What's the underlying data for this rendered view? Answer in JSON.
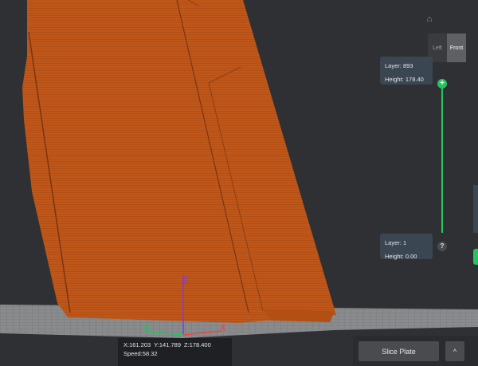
{
  "toolbar": {
    "home_icon": "home-icon",
    "view_left_label": "Left",
    "view_front_label": "Front"
  },
  "layer_slider": {
    "top": {
      "layer_label": "Layer:",
      "layer_value": "893",
      "height_label": "Height:",
      "height_value": "178.40"
    },
    "bottom": {
      "layer_label": "Layer:",
      "layer_value": "1",
      "height_label": "Height:",
      "height_value": "0.00"
    },
    "plus_icon": "+",
    "help_icon": "?",
    "accent_color": "#22c55e"
  },
  "axes": {
    "z_label": "Z",
    "y_label": "Y",
    "x_label": "X"
  },
  "coords": {
    "x": "X:161.203",
    "y": "Y:141.789",
    "z": "Z:178.400",
    "speed": "Speed:58.32"
  },
  "actions": {
    "slice_label": "Slice Plate",
    "expand_icon": "^"
  },
  "colors": {
    "model": "#c0571a",
    "background": "#2f3033",
    "plate": "#8a8b8c"
  }
}
